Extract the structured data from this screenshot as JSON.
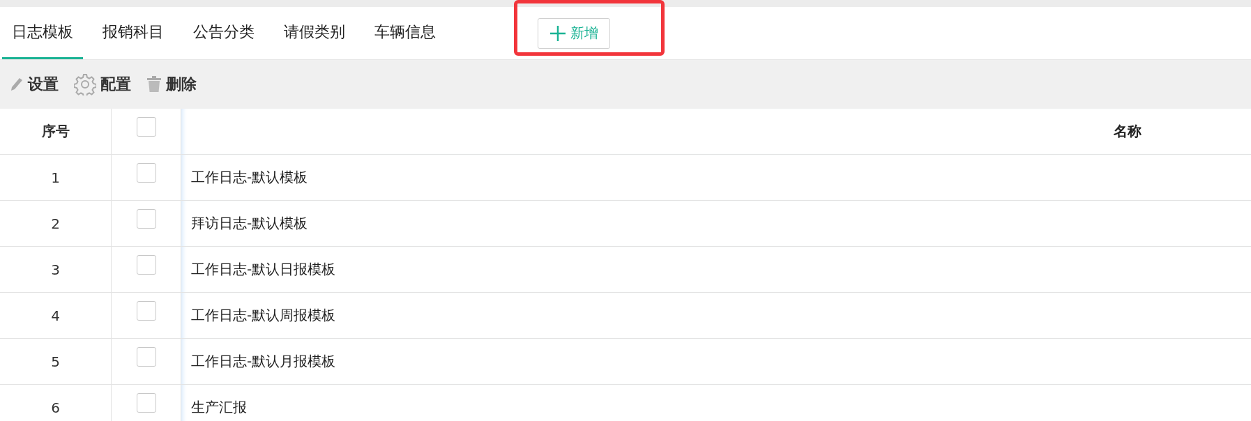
{
  "tabs": [
    {
      "label": "日志模板",
      "selected": true
    },
    {
      "label": "报销科目",
      "selected": false
    },
    {
      "label": "公告分类",
      "selected": false
    },
    {
      "label": "请假类别",
      "selected": false
    },
    {
      "label": "车辆信息",
      "selected": false
    }
  ],
  "add_button": {
    "label": "新增"
  },
  "toolbar": [
    {
      "kind": "edit",
      "label": "设置"
    },
    {
      "kind": "gear",
      "label": "配置"
    },
    {
      "kind": "trash",
      "label": "删除"
    }
  ],
  "table": {
    "columns": [
      "序号",
      "名称"
    ],
    "header_checked": false,
    "rows": [
      {
        "index": "1",
        "name": "工作日志-默认模板",
        "checked": false
      },
      {
        "index": "2",
        "name": "拜访日志-默认模板",
        "checked": false
      },
      {
        "index": "3",
        "name": "工作日志-默认日报模板",
        "checked": false
      },
      {
        "index": "4",
        "name": "工作日志-默认周报模板",
        "checked": false
      },
      {
        "index": "5",
        "name": "工作日志-默认月报模板",
        "checked": false
      },
      {
        "index": "6",
        "name": "生产汇报",
        "checked": false
      }
    ]
  }
}
